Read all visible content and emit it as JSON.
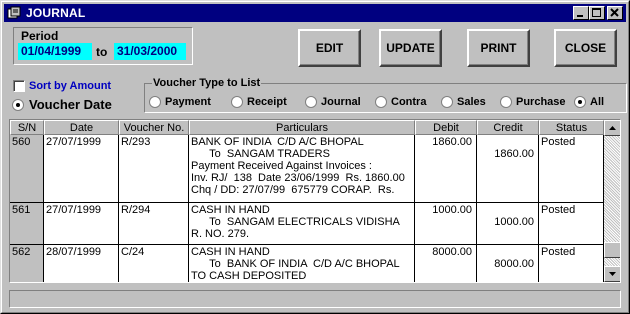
{
  "window": {
    "title": "JOURNAL"
  },
  "period": {
    "label": "Period",
    "from": "01/04/1999",
    "to_word": "to",
    "to": "31/03/2000"
  },
  "toolbar": {
    "edit": "EDIT",
    "update": "UPDATE",
    "print": "PRINT",
    "close": "CLOSE"
  },
  "sort": {
    "label": "Sort by Amount",
    "checked": false
  },
  "voucher_date": {
    "label": "Voucher Date",
    "selected": true
  },
  "voucher_type": {
    "legend": "Voucher Type to List",
    "options": [
      "Payment",
      "Receipt",
      "Journal",
      "Contra",
      "Sales",
      "Purchase",
      "All"
    ],
    "selected": "All"
  },
  "grid": {
    "columns": [
      "S/N",
      "Date",
      "Voucher No.",
      "Particulars",
      "Debit",
      "Credit",
      "Status"
    ],
    "rows": [
      {
        "sn": "560",
        "date": "27/07/1999",
        "voucher": "R/293",
        "particulars": "BANK OF INDIA  C/D A/C BHOPAL\n      To  SANGAM TRADERS\nPayment Received Against Invoices :\nInv. RJ/  138  Date 23/06/1999  Rs. 1860.00\nChq / DD: 27/07/99  675779 CORAP.  Rs.",
        "debit": "1860.00",
        "credit": "\n1860.00",
        "status": "Posted"
      },
      {
        "sn": "561",
        "date": "27/07/1999",
        "voucher": "R/294",
        "particulars": "CASH IN HAND\n      To  SANGAM ELECTRICALS VIDISHA\nR. NO. 279.",
        "debit": "1000.00",
        "credit": "\n1000.00",
        "status": "Posted"
      },
      {
        "sn": "562",
        "date": "28/07/1999",
        "voucher": "C/24",
        "particulars": "CASH IN HAND\n      To  BANK OF INDIA  C/D A/C BHOPAL\nTO CASH DEPOSITED",
        "debit": "8000.00",
        "credit": "\n8000.00",
        "status": "Posted"
      }
    ]
  }
}
